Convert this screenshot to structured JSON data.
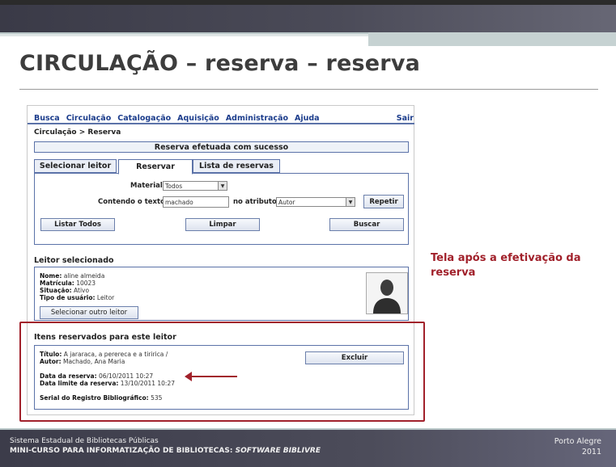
{
  "slide": {
    "title": "CIRCULAÇÃO – reserva – reserva",
    "annotation": "Tela após a efetivação da reserva",
    "accent_color": "#a1212b"
  },
  "menu": {
    "items": [
      "Busca",
      "Circulação",
      "Catalogação",
      "Aquisição",
      "Administração",
      "Ajuda"
    ],
    "exit": "Sair"
  },
  "breadcrumb": "Circulação > Reserva",
  "success_message": "Reserva efetuada com sucesso",
  "tabs": [
    "Selecionar leitor",
    "Reservar",
    "Lista de reservas"
  ],
  "active_tab": "Reservar",
  "search": {
    "material_label": "Material",
    "material_value": "Todos",
    "text_label": "Contendo o texto",
    "text_value": "machado",
    "attribute_label": "no atributo",
    "attribute_value": "Autor",
    "repeat_button": "Repetir",
    "list_all_button": "Listar Todos",
    "clear_button": "Limpar",
    "search_button": "Buscar"
  },
  "reader": {
    "section_title": "Leitor selecionado",
    "name_label": "Nome:",
    "name": "aline almeida",
    "enrollment_label": "Matrícula:",
    "enrollment": "10023",
    "status_label": "Situação:",
    "status": "Ativo",
    "user_type_label": "Tipo de usuário:",
    "user_type": "Leitor",
    "select_other_button": "Selecionar outro leitor"
  },
  "reserved": {
    "section_title": "Itens reservados para este leitor",
    "title_label": "Título:",
    "title": "A jararaca, a perereca e a tiririca /",
    "author_label": "Autor:",
    "author": "Machado, Ana Maria",
    "reserve_date_label": "Data da reserva:",
    "reserve_date": "06/10/2011 10:27",
    "limit_date_label": "Data limite da reserva:",
    "limit_date": "13/10/2011 10:27",
    "serial_label": "Serial do Registro Bibliográfico:",
    "serial": "535",
    "delete_button": "Excluir"
  },
  "footer": {
    "line1": "Sistema Estadual de Bibliotecas Públicas",
    "line2_prefix": "MINI-CURSO PARA INFORMATIZAÇÃO DE BIBLIOTECAS: ",
    "line2_italic": "SOFTWARE BIBLIVRE",
    "city": "Porto Alegre",
    "year": "2011"
  }
}
